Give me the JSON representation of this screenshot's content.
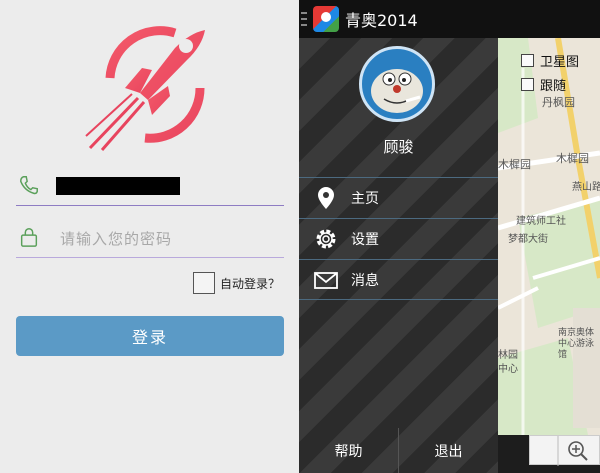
{
  "login": {
    "phone_icon": "phone-icon",
    "lock_icon": "lock-icon",
    "password_placeholder": "请输入您的密码",
    "auto_login_label": "自动登录？",
    "login_button": "登录"
  },
  "app": {
    "title": "青奥2014",
    "user_name": "顾骏",
    "menu": [
      {
        "label": "主页",
        "icon": "location-pin-icon"
      },
      {
        "label": "设置",
        "icon": "gear-icon"
      },
      {
        "label": "消息",
        "icon": "envelope-icon"
      }
    ],
    "help": "帮助",
    "exit": "退出"
  },
  "map": {
    "layers": [
      {
        "label": "卫星图"
      },
      {
        "label": "跟随"
      }
    ],
    "labels": [
      "丹枫园",
      "木樨园",
      "木樨园",
      "燕山路",
      "建筑师工社",
      "梦都大街",
      "南京奥体中心游泳馆",
      "林园",
      "中心"
    ]
  },
  "colors": {
    "login_button": "#5b9ac6",
    "logo": "#f0465f",
    "field_line": "#8e7cc3",
    "icon_green": "#5ba05b"
  }
}
